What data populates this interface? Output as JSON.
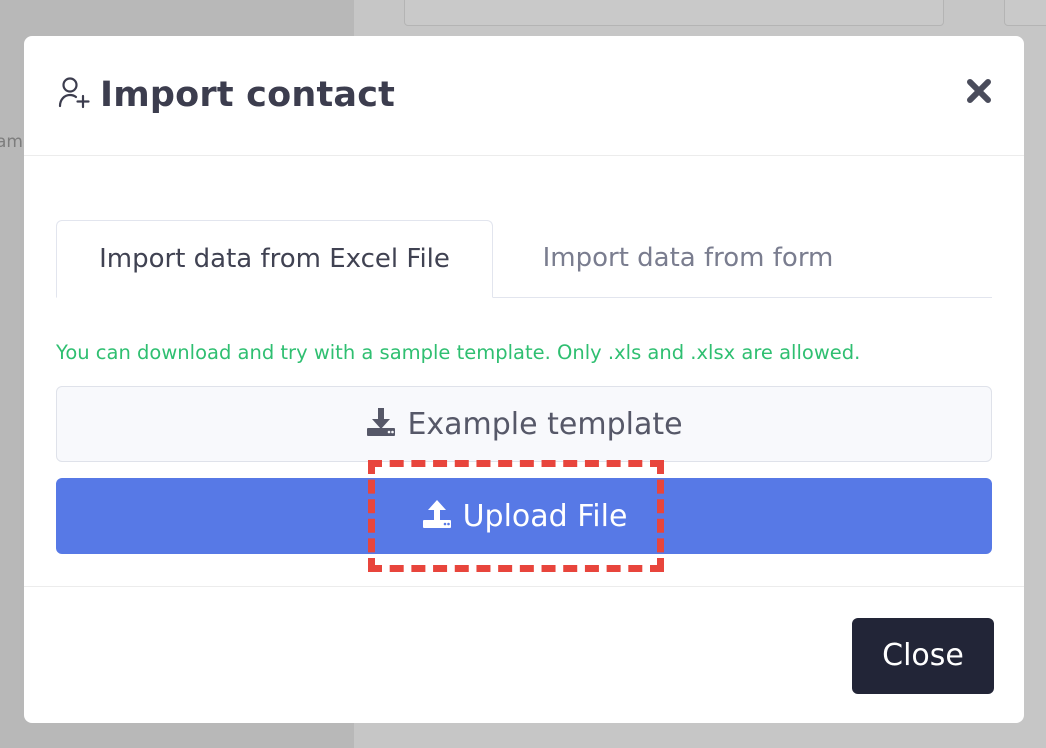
{
  "background": {
    "edge_text": "am"
  },
  "modal": {
    "title": "Import contact",
    "title_icon": "user-plus-icon",
    "close_icon": "close-icon"
  },
  "tabs": [
    {
      "label": "Import data from Excel File",
      "active": true
    },
    {
      "label": "Import data from form",
      "active": false
    }
  ],
  "hint": "You can download and try with a sample template. Only .xls and .xlsx are allowed.",
  "buttons": {
    "example_template": {
      "label": "Example template",
      "icon": "download-icon"
    },
    "upload_file": {
      "label": "Upload File",
      "icon": "upload-icon"
    },
    "close": {
      "label": "Close"
    }
  },
  "colors": {
    "primary": "#5779e6",
    "success_text": "#2fbf71",
    "dark_button": "#222537",
    "highlight": "#e8453c"
  }
}
